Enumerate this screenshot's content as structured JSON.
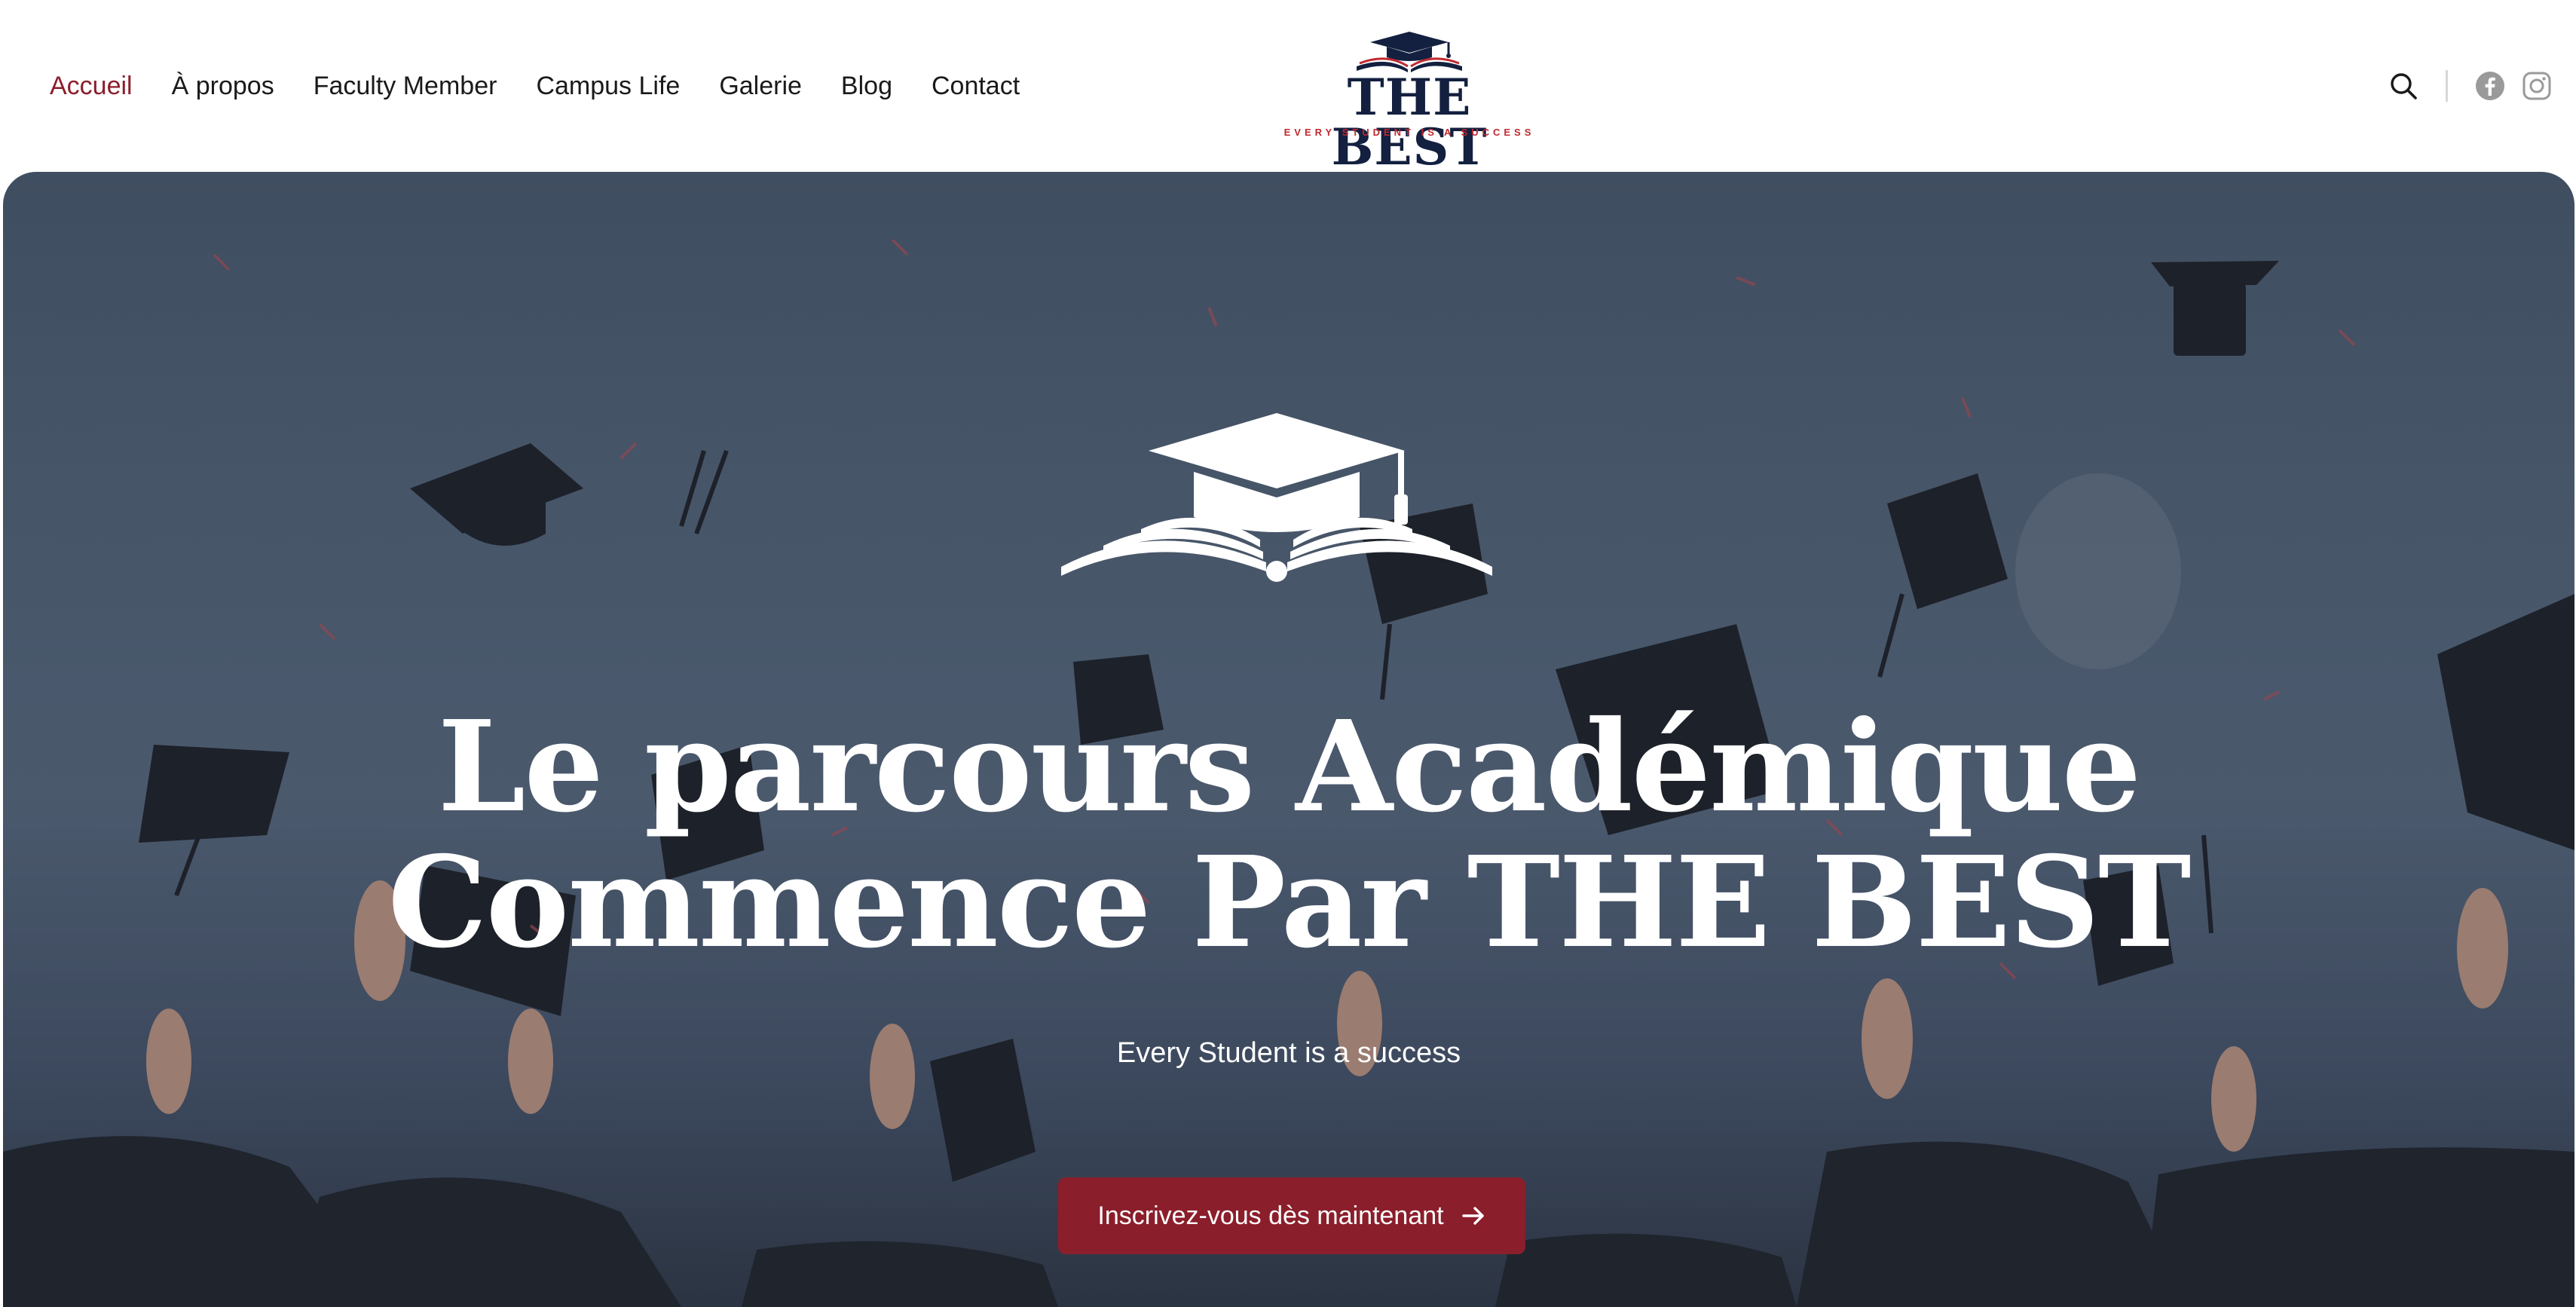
{
  "nav": {
    "items": [
      {
        "label": "Accueil",
        "active": true
      },
      {
        "label": "À propos",
        "active": false
      },
      {
        "label": "Faculty Member",
        "active": false
      },
      {
        "label": "Campus Life",
        "active": false
      },
      {
        "label": "Galerie",
        "active": false
      },
      {
        "label": "Blog",
        "active": false
      },
      {
        "label": "Contact",
        "active": false
      }
    ]
  },
  "logo": {
    "title": "THE BEST",
    "tagline": "EVERY STUDENT IS A SUCCESS"
  },
  "tools": {
    "search_icon": "search-icon",
    "social": [
      "facebook-icon",
      "instagram-icon"
    ]
  },
  "hero": {
    "title_line1": "Le parcours Académique",
    "title_line2": "Commence Par THE BEST",
    "subtitle": "Every Student is a success",
    "cta_label": "Inscrivez-vous dès maintenant"
  },
  "colors": {
    "accent": "#8b1e2b",
    "brand_navy": "#13203f",
    "brand_red": "#c0282f"
  }
}
